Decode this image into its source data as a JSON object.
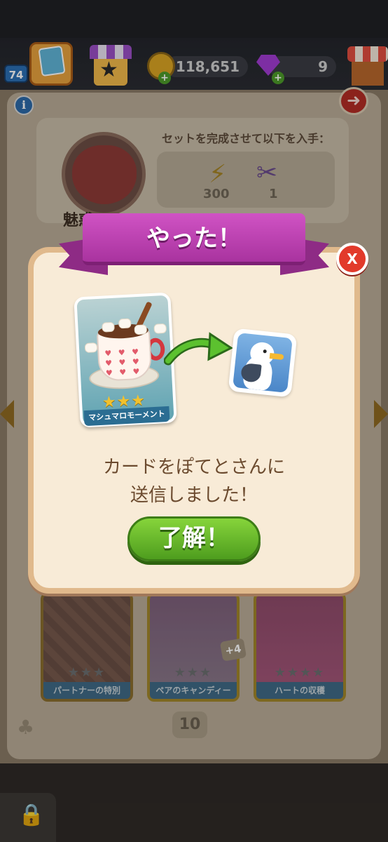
{
  "header": {
    "level": "74",
    "coins": "118,651",
    "gems": "9",
    "plus": "+"
  },
  "album": {
    "info_label": "i",
    "set_title": "セットを完成させて以下を入手：",
    "rewards": [
      {
        "icon": "lightning-icon",
        "value": "300"
      },
      {
        "icon": "scissors-icon",
        "value": "1"
      }
    ],
    "set_name": "魅惑の",
    "cards": [
      {
        "label": "パートナーの特別",
        "stars": "★★★"
      },
      {
        "label": "ペアのキャンディー",
        "stars": "★★★"
      },
      {
        "label": "ハートの収穫",
        "stars": "★★★★"
      }
    ],
    "bonus": "+4",
    "page_number": "10"
  },
  "dialog": {
    "title": "やった！",
    "close_label": "X",
    "card": {
      "name": "マシュマロモーメント",
      "stars": "★★★",
      "star_count": 3
    },
    "message_line1": "カードをぽてとさんに",
    "message_line2": "送信しました！",
    "ok_label": "了解！"
  },
  "colors": {
    "ribbon": "#b73aac",
    "ok_button": "#5fae26",
    "close_button": "#e23a2b",
    "dialog_bg": "#f8ebd7"
  }
}
